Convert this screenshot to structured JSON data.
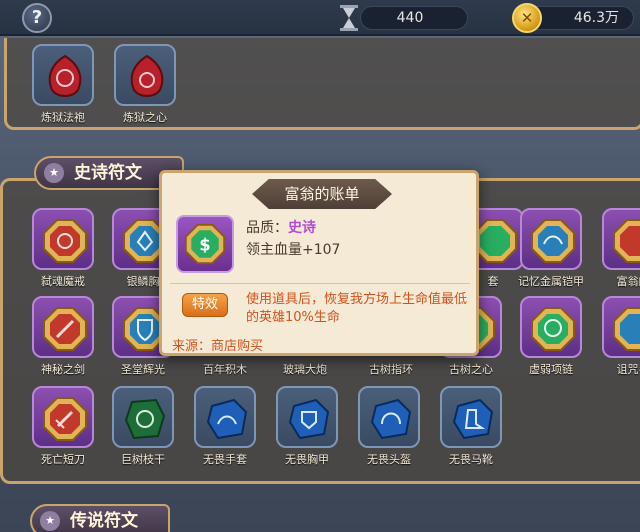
{
  "topbar": {
    "help_label": "?",
    "resource_a": "440",
    "coin_symbol": "✕",
    "resource_b": "46.3万"
  },
  "top_row": {
    "items": [
      {
        "label": "炼狱法袍",
        "color": "#b8202a"
      },
      {
        "label": "炼狱之心",
        "color": "#b8202a"
      }
    ]
  },
  "epic_section": {
    "title": "史诗符文",
    "row1": [
      {
        "label": "弑魂魔戒",
        "color": "#c0392b"
      },
      {
        "label": "银鳞胸",
        "color": "#2980b9"
      },
      {
        "label": "套",
        "color": "#27ae60"
      },
      {
        "label": "记忆金属铠甲",
        "color": "#2980b9"
      },
      {
        "label": "富翁的",
        "color": "#c0392b"
      }
    ],
    "row2": [
      {
        "label": "神秘之剑",
        "color": "#c0392b"
      },
      {
        "label": "圣堂辉光",
        "color": "#2980b9"
      },
      {
        "label": "百年积木",
        "color": ""
      },
      {
        "label": "玻璃大炮",
        "color": ""
      },
      {
        "label": "古树指环",
        "color": ""
      },
      {
        "label": "古树之心",
        "color": "#27ae60"
      },
      {
        "label": "虚弱项链",
        "color": "#27ae60"
      },
      {
        "label": "诅咒手",
        "color": "#2980b9"
      }
    ],
    "row3": [
      {
        "label": "死亡短刀",
        "color": "#c0392b"
      },
      {
        "label": "巨树枝干",
        "color": "#1f6e3a"
      },
      {
        "label": "无畏手套",
        "color": "#1f5fb8"
      },
      {
        "label": "无畏胸甲",
        "color": "#1f5fb8"
      },
      {
        "label": "无畏头盔",
        "color": "#1f5fb8"
      },
      {
        "label": "无畏马靴",
        "color": "#1f5fb8"
      }
    ]
  },
  "legend_section": {
    "title": "传说符文"
  },
  "popup": {
    "title": "富翁的账单",
    "icon_symbol": "$",
    "quality_label": "品质：",
    "quality_value": "史诗",
    "effect": "领主血量+107",
    "special_button": "特效",
    "special_text": "使用道具后，恢复我方场上生命值最低的英雄10%生命",
    "source": "来源：商店购买"
  },
  "colors": {
    "frame_gold": "#c9a56d",
    "epic_purple": "#b24cd6",
    "accent_orange": "#d2531c"
  }
}
